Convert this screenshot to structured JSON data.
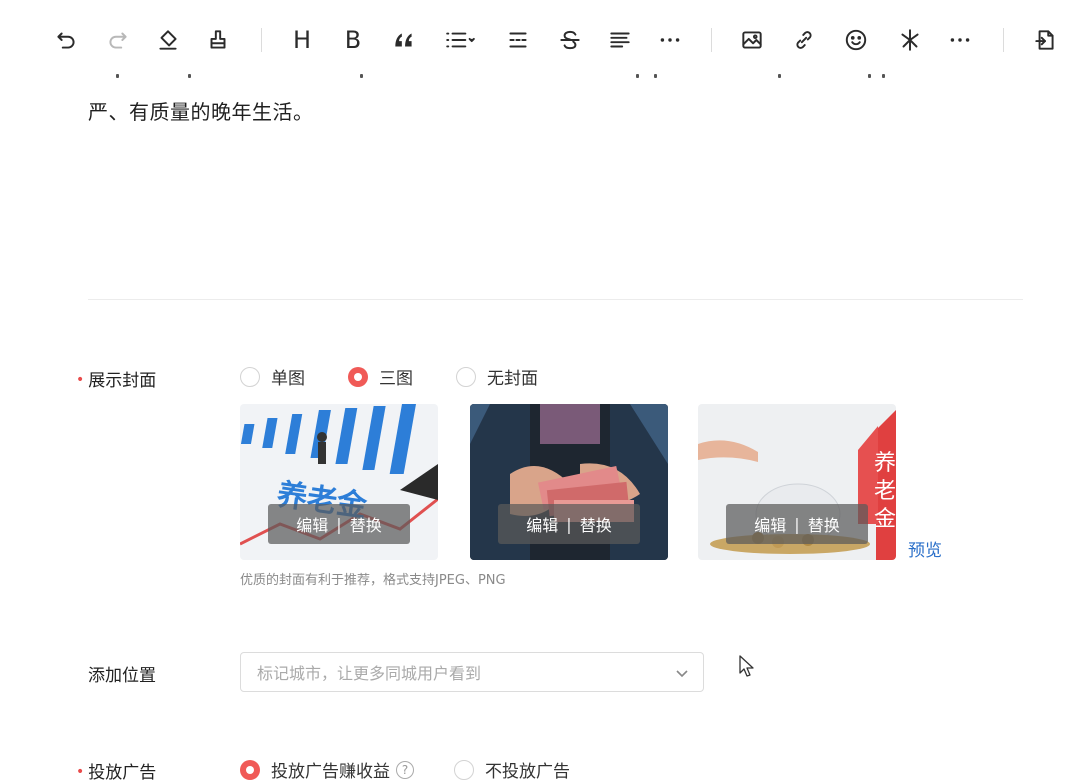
{
  "toolbar": {
    "icons": [
      "undo-icon",
      "redo-icon",
      "eraser-icon",
      "format-painter-icon",
      "heading-icon",
      "bold-icon",
      "quote-icon",
      "list-icon",
      "divider-icon",
      "strikethrough-icon",
      "align-icon",
      "more-icon",
      "image-icon",
      "link-icon",
      "emoji-icon",
      "sparkle-icon",
      "more-icon",
      "insert-doc-icon"
    ],
    "heading_label": "H",
    "bold_label": "B",
    "quote_label": "66"
  },
  "editor": {
    "body_text": "严、有质量的晚年生活。"
  },
  "cover": {
    "label": "展示封面",
    "options": [
      {
        "label": "单图",
        "checked": false
      },
      {
        "label": "三图",
        "checked": true
      },
      {
        "label": "无封面",
        "checked": false
      }
    ],
    "images": [
      {
        "edit_label": "编辑",
        "replace_label": "替换",
        "separator": "|",
        "overlay_text": "养老金"
      },
      {
        "edit_label": "编辑",
        "replace_label": "替换",
        "separator": "|"
      },
      {
        "edit_label": "编辑",
        "replace_label": "替换",
        "separator": "|",
        "overlay_text": "养老金"
      }
    ],
    "preview_label": "预览",
    "hint": "优质的封面有利于推荐，格式支持JPEG、PNG"
  },
  "location": {
    "label": "添加位置",
    "placeholder": "标记城市，让更多同城用户看到"
  },
  "ads": {
    "label": "投放广告",
    "options": [
      {
        "label": "投放广告赚收益",
        "checked": true,
        "help": "?"
      },
      {
        "label": "不投放广告",
        "checked": false
      }
    ]
  },
  "colors": {
    "accent_red": "#f05a57",
    "link_blue": "#2a6fc9"
  }
}
